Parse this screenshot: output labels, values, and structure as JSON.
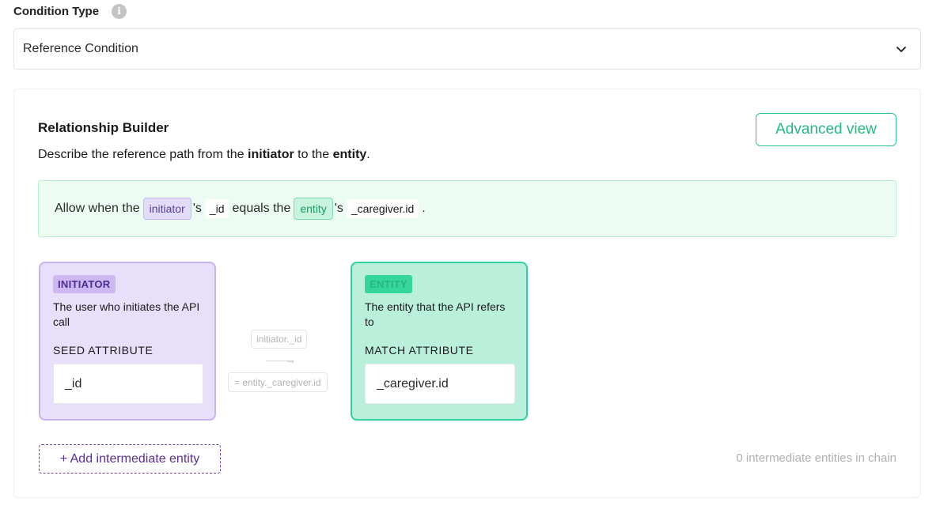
{
  "condition_type": {
    "label": "Condition Type",
    "info_icon_glyph": "i",
    "selected_value": "Reference Condition"
  },
  "builder": {
    "title": "Relationship Builder",
    "desc_prefix": "Describe the reference path from the ",
    "desc_initiator": "initiator",
    "desc_middle": " to the ",
    "desc_entity": "entity",
    "desc_suffix": ".",
    "advanced_view_label": "Advanced view"
  },
  "summary": {
    "allow_when_the": "Allow when the",
    "initiator_tag": "initiator",
    "possessive": "'s",
    "seed_attr": "_id",
    "equals_the": "equals the",
    "entity_tag": "entity",
    "match_attr": "_caregiver.id",
    "period": "."
  },
  "initiator_card": {
    "badge": "INITIATOR",
    "description": "The user who initiates the API call",
    "attr_label": "SEED ATTRIBUTE",
    "attr_value": "_id"
  },
  "connector": {
    "top_label": "initiator._id",
    "arrow_glyph": "→",
    "bottom_label": "= entity._caregiver.id"
  },
  "entity_card": {
    "badge": "ENTITY",
    "description": "The entity that the API refers to",
    "attr_label": "MATCH ATTRIBUTE",
    "attr_value": "_caregiver.id"
  },
  "footer": {
    "add_button_label": "+ Add intermediate entity",
    "chain_count_text": "0 intermediate entities in chain"
  },
  "colors": {
    "accent_green": "#22b981",
    "accent_purple": "#5b2d97",
    "summary_bg": "#ecfcf3",
    "initiator_bg": "#e8dffa",
    "entity_bg": "#b9efdb"
  }
}
